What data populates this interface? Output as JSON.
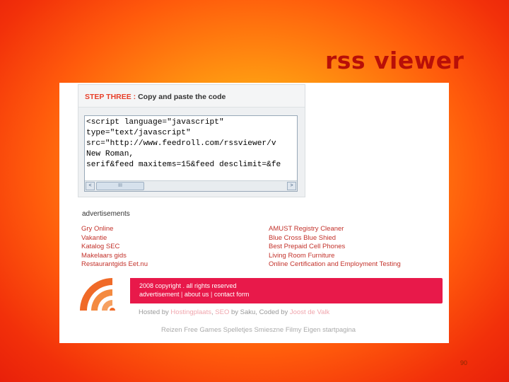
{
  "slide": {
    "title": "rss viewer",
    "page_number": "90"
  },
  "step": {
    "label": "STEP THREE :",
    "title": "Copy and paste the code",
    "code_lines": [
      "<script language=\"javascript\"",
      "type=\"text/javascript\"",
      "src=\"http://www.feedroll.com/rssviewer/v",
      "New Roman,",
      "serif&feed maxitems=15&feed desclimit=&fe"
    ],
    "scroll_left_glyph": "<",
    "scroll_right_glyph": ">",
    "scroll_thumb_glyph": "III"
  },
  "ads": {
    "heading": "advertisements",
    "left": [
      "Gry Online",
      "Vakantie",
      "Katalog SEC",
      "Makelaars gids",
      "Restaurantgids Eet.nu"
    ],
    "right": [
      "AMUST Registry Cleaner",
      "Blue Cross Blue Shied",
      "Best Prepaid Cell Phones",
      "Living Room Furniture",
      "Online Certification and Employment Testing"
    ]
  },
  "footer": {
    "copyright": "2008 copyright . all rights reserved",
    "link_advertisement": "advertisement",
    "link_about": "about us",
    "link_contact": "contact form",
    "sep": "|"
  },
  "hosted": {
    "prefix": "Hosted by",
    "host": "Hostingplaats",
    "seo_prefix": ",",
    "seo": "SEO",
    "seo_by": "by Saku, Coded by",
    "coder": "Joost de Valk"
  },
  "partners": "Reizen Free Games Spelletjes Smieszne Filmy Eigen startpagina",
  "colors": {
    "accent_red": "#e8194a",
    "title_red": "#b80f08",
    "link_red": "#c3322b",
    "rss_orange": "#f06a28"
  }
}
